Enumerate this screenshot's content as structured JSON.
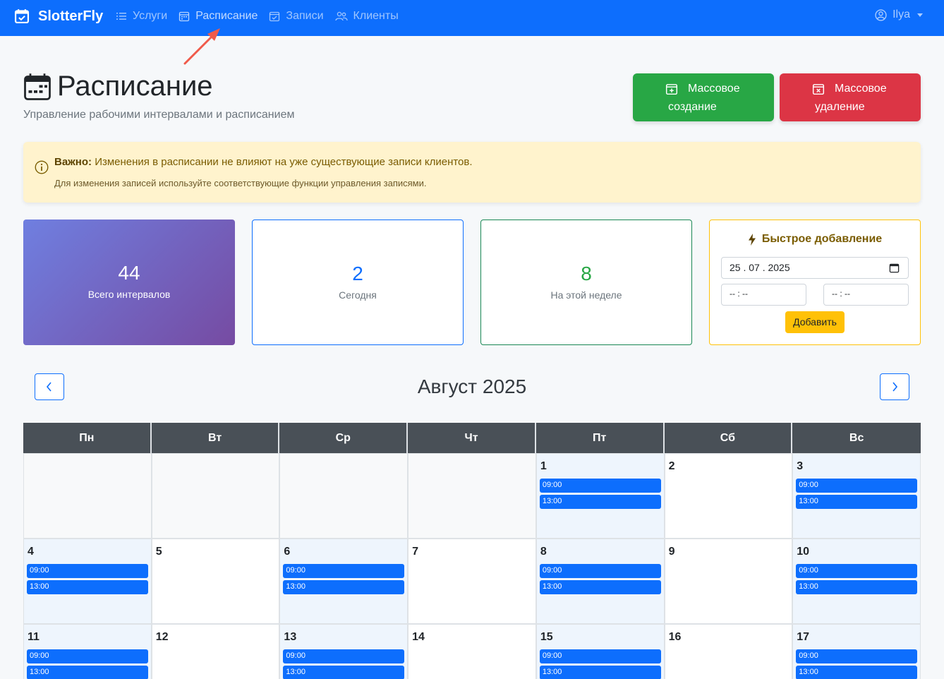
{
  "navbar": {
    "brand": "SlotterFly",
    "items": [
      {
        "label": "Услуги",
        "icon": "list-icon"
      },
      {
        "label": "Расписание",
        "icon": "calendar-icon"
      },
      {
        "label": "Записи",
        "icon": "calendar-check-icon"
      },
      {
        "label": "Клиенты",
        "icon": "people-icon"
      }
    ],
    "user": "Ilya"
  },
  "header": {
    "title": "Расписание",
    "subtitle": "Управление рабочими интервалами и расписанием",
    "bulk_create_l1": "Массовое",
    "bulk_create_l2": "создание",
    "bulk_delete_l1": "Массовое",
    "bulk_delete_l2": "удаление"
  },
  "alert": {
    "strong": "Важно:",
    "text": " Изменения в расписании не влияют на уже существующие записи клиентов.",
    "sub": "Для изменения записей используйте соответствующие функции управления записями."
  },
  "stats": {
    "total_value": "44",
    "total_label": "Всего интервалов",
    "today_value": "2",
    "today_label": "Сегодня",
    "week_value": "8",
    "week_label": "На этой неделе"
  },
  "quick_add": {
    "title": "Быстрое добавление",
    "date_value": "25 . 07 . 2025",
    "time_start": "-- : --",
    "time_end": "-- : --",
    "button": "Добавить"
  },
  "calendar": {
    "month": "Август 2025",
    "weekdays": [
      "Пн",
      "Вт",
      "Ср",
      "Чт",
      "Пт",
      "Сб",
      "Вс"
    ],
    "leading_empty": 4,
    "days": [
      {
        "day": "1",
        "slots": [
          "09:00",
          "13:00"
        ]
      },
      {
        "day": "2",
        "slots": []
      },
      {
        "day": "3",
        "slots": [
          "09:00",
          "13:00"
        ]
      },
      {
        "day": "4",
        "slots": [
          "09:00",
          "13:00"
        ]
      },
      {
        "day": "5",
        "slots": []
      },
      {
        "day": "6",
        "slots": [
          "09:00",
          "13:00"
        ]
      },
      {
        "day": "7",
        "slots": []
      },
      {
        "day": "8",
        "slots": [
          "09:00",
          "13:00"
        ]
      },
      {
        "day": "9",
        "slots": []
      },
      {
        "day": "10",
        "slots": [
          "09:00",
          "13:00"
        ]
      },
      {
        "day": "11",
        "slots": [
          "09:00",
          "13:00"
        ]
      },
      {
        "day": "12",
        "slots": []
      },
      {
        "day": "13",
        "slots": [
          "09:00",
          "13:00"
        ]
      },
      {
        "day": "14",
        "slots": []
      },
      {
        "day": "15",
        "slots": [
          "09:00",
          "13:00"
        ]
      },
      {
        "day": "16",
        "slots": []
      },
      {
        "day": "17",
        "slots": [
          "09:00",
          "13:00"
        ]
      }
    ]
  },
  "colors": {
    "primary": "#0d6efd",
    "success": "#28a745",
    "danger": "#dc3545",
    "warning": "#ffc107",
    "annotation_arrow": "#f05a4a"
  }
}
